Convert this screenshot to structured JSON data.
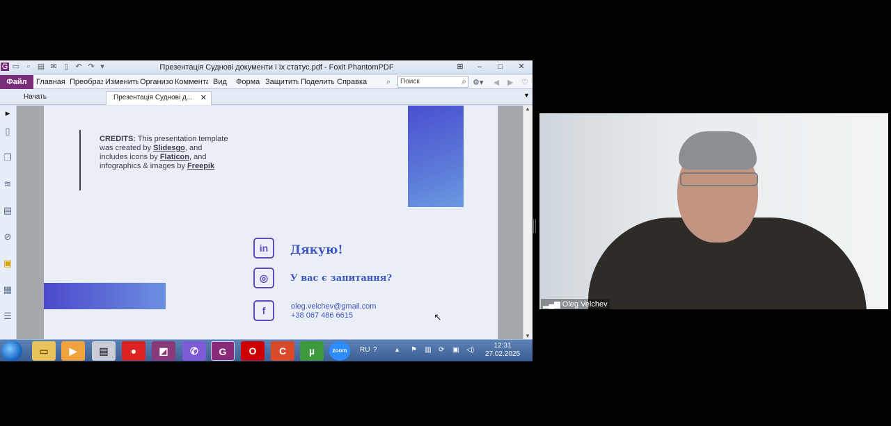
{
  "window": {
    "title": "Презентація Судновi документи i їх статус.pdf - Foxit PhantomPDF"
  },
  "menu": {
    "file": "Файл",
    "items": [
      "Главная",
      "Преобразовать",
      "Изменить",
      "Организовать",
      "Комментарий",
      "Вид",
      "Форма",
      "Защитить",
      "Поделиться",
      "Справка"
    ],
    "search_placeholder": "Поиск"
  },
  "tabs": [
    {
      "label": "Начать"
    },
    {
      "label": "Презентація Судновi д..."
    }
  ],
  "slide": {
    "credits_label": "CREDITS:",
    "credits_text_1": " This presentation template was created by ",
    "credits_link_1": "Slidesgo",
    "credits_text_2": ", and includes icons by ",
    "credits_link_2": "Flaticon",
    "credits_text_3": ", and infographics & images by ",
    "credits_link_3": "Freepik",
    "thanks": "Дякую!",
    "question": "У вас є запитання?",
    "email": "oleg.velchev@gmail.com",
    "phone": "+38 067 486 6615"
  },
  "taskbar": {
    "lang": "RU",
    "time": "12:31",
    "date": "27.02.2025"
  },
  "video": {
    "participant": "Oleg Velchev"
  }
}
